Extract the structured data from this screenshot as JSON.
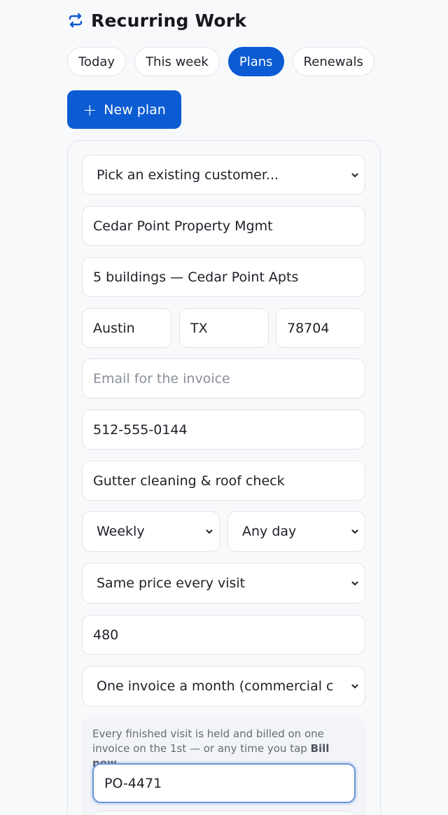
{
  "header": {
    "title": "Recurring Work",
    "icon": "repeat-icon"
  },
  "tabs": [
    {
      "label": "Today",
      "active": false
    },
    {
      "label": "This week",
      "active": false
    },
    {
      "label": "Plans",
      "active": true
    },
    {
      "label": "Renewals",
      "active": false
    }
  ],
  "new_plan": {
    "label": "New plan",
    "icon": "plus-icon"
  },
  "form": {
    "customer_select": "Pick an existing customer...",
    "customer_name": "Cedar Point Property Mgmt",
    "site": "5 buildings — Cedar Point Apts",
    "city": "Austin",
    "state": "TX",
    "zip": "78704",
    "email_placeholder": "Email for the invoice",
    "phone": "512-555-0144",
    "service": "Gutter cleaning & roof check",
    "frequency": "Weekly",
    "day": "Any day",
    "pricing": "Same price every visit",
    "price": "480",
    "billing": "One invoice a month (commercial c",
    "notice_text": "Every finished visit is held and billed on one invoice on the 1st — or any time you tap ",
    "notice_bold": "Bill now.",
    "po_number": "PO-4471"
  },
  "colors": {
    "accent": "#0b5bd3",
    "focus_border": "#6a93d6"
  }
}
